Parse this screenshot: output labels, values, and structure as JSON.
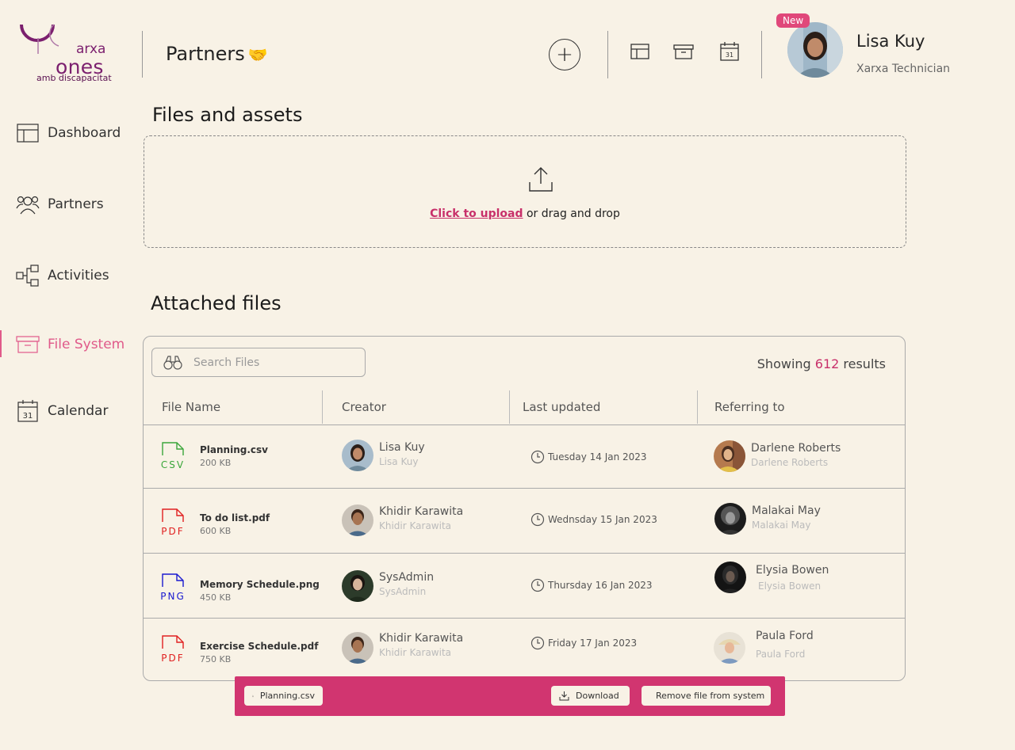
{
  "brand": {
    "logo_line1": "arxa",
    "logo_line2": "ones",
    "logo_line3": "amb discapacitat"
  },
  "header": {
    "title": "Partners",
    "title_emoji": "🤝",
    "add_icon": "plus-icon",
    "quick_icons": [
      "layout-icon",
      "archive-icon",
      "calendar-icon"
    ],
    "calendar_day": "31"
  },
  "user": {
    "badge": "New",
    "name": "Lisa Kuy",
    "role": "Xarxa Technician"
  },
  "sidebar": {
    "items": [
      {
        "label": "Dashboard",
        "icon": "layout-icon"
      },
      {
        "label": "Partners",
        "icon": "users-icon"
      },
      {
        "label": "Activities",
        "icon": "flow-icon"
      },
      {
        "label": "File System",
        "icon": "archive-icon",
        "active": true
      },
      {
        "label": "Calendar",
        "icon": "calendar-icon"
      }
    ],
    "calendar_day": "31"
  },
  "upload": {
    "title": "Files and assets",
    "link": "Click to upload",
    "rest": " or drag and drop"
  },
  "files": {
    "title": "Attached files",
    "search_placeholder": "Search Files",
    "results_prefix": "Showing ",
    "results_count": "612",
    "results_suffix": " results",
    "columns": [
      "File Name",
      "Creator",
      "Last updated",
      "Referring to"
    ],
    "rows": [
      {
        "type": "CSV",
        "type_color": "#3aa63a",
        "name": "Planning.csv",
        "size": "200 KB",
        "creator": "Lisa Kuy",
        "creator_sub": "Lisa Kuy",
        "date": "Tuesday 14  Jan 2023",
        "ref": "Darlene Roberts",
        "ref_sub": "Darlene Roberts"
      },
      {
        "type": "PDF",
        "type_color": "#e02020",
        "name": "To do list.pdf",
        "size": "600 KB",
        "creator": "Khidir Karawita",
        "creator_sub": "Khidir Karawita",
        "date": "Wednsday 15  Jan 2023",
        "ref": "Malakai May",
        "ref_sub": "Malakai May"
      },
      {
        "type": "PNG",
        "type_color": "#1a1ad0",
        "name": "Memory Schedule.png",
        "size": "450 KB",
        "creator": "SysAdmin",
        "creator_sub": "SysAdmin",
        "date": "Thursday 16  Jan 2023",
        "ref": "Elysia Bowen",
        "ref_sub": "Elysia Bowen"
      },
      {
        "type": "PDF",
        "type_color": "#e02020",
        "name": "Exercise Schedule.pdf",
        "size": "750 KB",
        "creator": "Khidir Karawita",
        "creator_sub": "Khidir Karawita",
        "date": "Friday 17  Jan 2023",
        "ref": "Paula Ford",
        "ref_sub": "Paula Ford"
      }
    ]
  },
  "action_bar": {
    "selected_file": "Planning.csv",
    "selected_file_tag": "csv",
    "download": "Download",
    "remove": "Remove file from system"
  },
  "colors": {
    "accent": "#d13570",
    "background": "#f8f2e6",
    "brand_purple": "#7b1f6e"
  }
}
